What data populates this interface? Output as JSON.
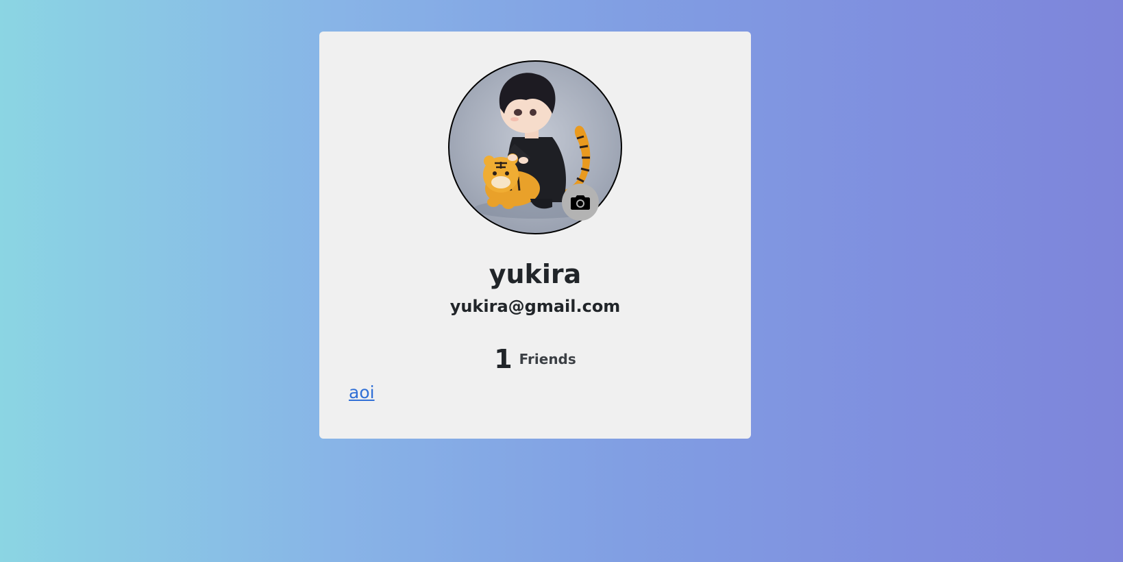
{
  "profile": {
    "username": "yukira",
    "email": "yukira@gmail.com"
  },
  "stats": {
    "friends_count": "1",
    "friends_label": "Friends"
  },
  "friends": [
    {
      "name": "aoi"
    }
  ],
  "icons": {
    "camera": "camera-icon"
  },
  "colors": {
    "card_bg": "#f0f0f0",
    "link": "#2f6fd6",
    "text": "#212529",
    "camera_button_bg": "#b3b3b3"
  }
}
